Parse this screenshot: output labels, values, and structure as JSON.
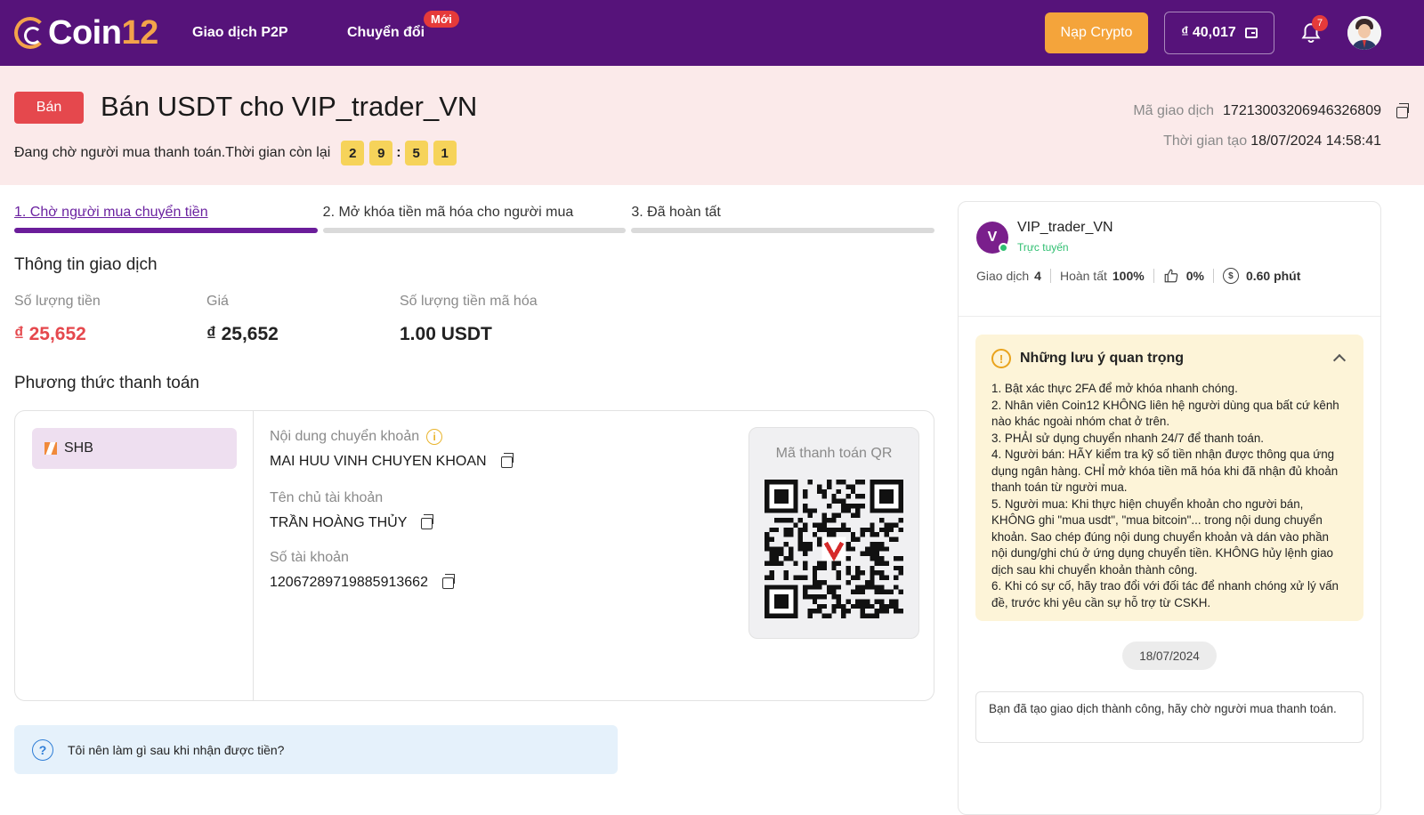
{
  "nav": {
    "logo_prefix": "Coin",
    "logo_suffix": "12",
    "p2p": "Giao dịch P2P",
    "convert": "Chuyển đổi",
    "convert_badge": "Mới",
    "deposit": "Nạp Crypto",
    "wallet_balance": "₫ 40,017",
    "notification_count": "7"
  },
  "header": {
    "side_button": "Bán",
    "title": "Bán USDT cho VIP_trader_VN",
    "waiting_text": "Đang chờ người mua thanh toán.Thời gian còn lại",
    "timer": [
      "2",
      "9",
      "5",
      "1"
    ],
    "timer_sep": ":",
    "txn_id_label": "Mã giao dịch",
    "txn_id": "17213003206946326809",
    "created_label": "Thời gian tạo",
    "created_at": "18/07/2024 14:58:41"
  },
  "steps": [
    {
      "label": "1. Chờ người mua chuyển tiền",
      "active": true
    },
    {
      "label": "2. Mở khóa tiền mã hóa cho người mua",
      "active": false
    },
    {
      "label": "3. Đã hoàn tất",
      "active": false
    }
  ],
  "transaction": {
    "section_title": "Thông tin giao dịch",
    "amount_label": "Số lượng tiền",
    "amount": "₫ 25,652",
    "price_label": "Giá",
    "price": "₫ 25,652",
    "crypto_label": "Số lượng tiền mã hóa",
    "crypto": "1.00 USDT"
  },
  "payment": {
    "section_title": "Phương thức thanh toán",
    "bank": "SHB",
    "content_label": "Nội dung chuyển khoản",
    "content_value": "MAI HUU VINH CHUYEN KHOAN",
    "holder_label": "Tên chủ tài khoản",
    "holder_value": "TRẦN HOÀNG THỦY",
    "account_label": "Số tài khoản",
    "account_value": "12067289719885913662",
    "qr_title": "Mã thanh toán QR"
  },
  "faq": "Tôi nên làm gì sau khi nhận được tiền?",
  "trader": {
    "initial": "V",
    "name": "VIP_trader_VN",
    "status": "Trực tuyến",
    "trades_label": "Giao dịch",
    "trades": "4",
    "completion_label": "Hoàn tất",
    "completion": "100%",
    "positive": "0%",
    "release_time": "0.60 phút"
  },
  "notes": {
    "title": "Những lưu ý quan trọng",
    "items": [
      "1.  Bật xác thực 2FA để mở khóa nhanh chóng.",
      "2.  Nhân viên Coin12 KHÔNG liên hệ người dùng qua bất cứ kênh nào khác ngoài nhóm chat ở trên.",
      "3.  PHẢI sử dụng chuyển nhanh 24/7 để thanh toán.",
      "4.  Người bán: HÃY kiểm tra kỹ số tiền nhận được thông qua ứng dụng ngân hàng. CHỈ mở khóa tiền mã hóa khi đã nhận đủ khoản thanh toán từ người mua.",
      "5.  Người mua: Khi thực hiện chuyển khoản cho người bán, KHÔNG ghi \"mua usdt\", \"mua bitcoin\"... trong nội dung chuyển khoản. Sao chép đúng nội dung chuyển khoản và dán vào phần nội dung/ghi chú ở ứng dụng chuyển tiền. KHÔNG hủy lệnh giao dịch sau khi chuyển khoản thành công.",
      "6.  Khi có sự cố, hãy trao đổi với đối tác để nhanh chóng xử lý vấn đề, trước khi yêu cần sự hỗ trợ từ CSKH."
    ]
  },
  "chat": {
    "date": "18/07/2024",
    "message": "Bạn đã tạo giao dịch thành công, hãy chờ người mua thanh toán."
  },
  "colors": {
    "nav_bg": "#56137a",
    "accent_orange": "#f4a43b",
    "sell_red": "#e5484d",
    "header_bg": "#fbeaea"
  }
}
